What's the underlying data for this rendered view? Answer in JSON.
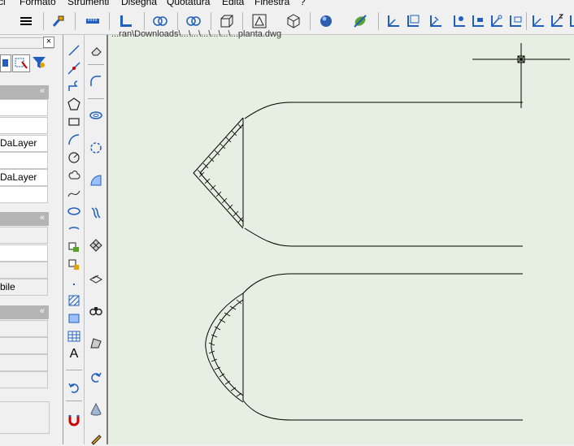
{
  "menu": {
    "items": [
      "ci",
      "Formato",
      "Strumenti",
      "Disegna",
      "Quotatura",
      "Edita",
      "Finestra",
      "?"
    ]
  },
  "properties": {
    "rows": [
      "DaLayer",
      "DaLayer",
      "bile"
    ],
    "close_glyph": "×",
    "collapse_glyph": "«"
  },
  "canvas": {
    "document_title": "...ran\\Downloads\\...\\...\\...\\...\\...\\...planta.dwg"
  },
  "vertical_toolbar": {
    "text_tool_label": "A"
  },
  "colors": {
    "canvas_bg": "#e6efe2",
    "panel_header": "#b4b4b4",
    "accent_blue": "#1f5fbf"
  }
}
